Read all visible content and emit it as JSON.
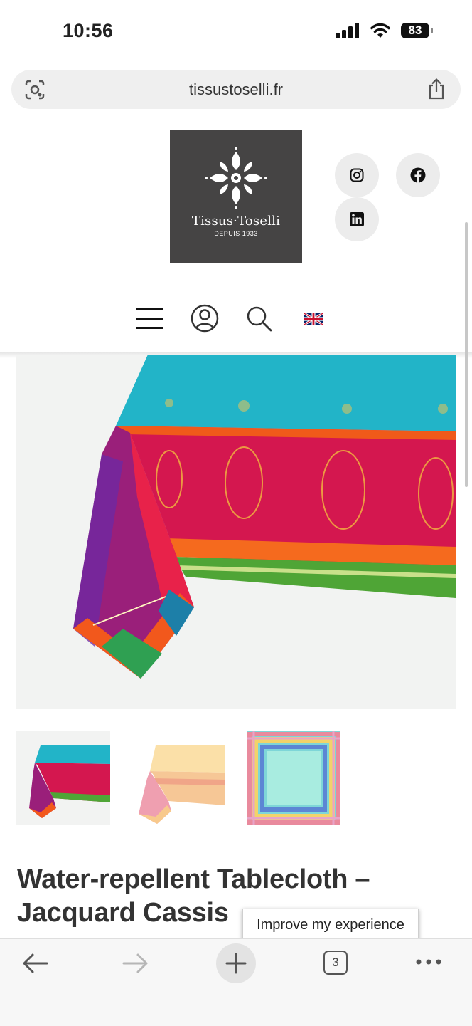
{
  "status_bar": {
    "time": "10:56",
    "battery": "83"
  },
  "browser": {
    "url": "tissustoselli.fr",
    "open_tabs": "3"
  },
  "header": {
    "logo_name": "Tissus·Toselli",
    "logo_tagline": "DEPUIS 1933",
    "social_icons": [
      "instagram-icon",
      "facebook-icon",
      "linkedin-icon"
    ],
    "nav_icons": [
      "menu-icon",
      "account-icon",
      "search-icon",
      "uk-flag-icon"
    ]
  },
  "product": {
    "title": "Water-repellent Tablecloth – Jacquard Cassis",
    "thumbnails": [
      "thumb-cassis",
      "thumb-peach",
      "thumb-pastel"
    ]
  },
  "cookie": {
    "improve_label": "Improve my experience"
  },
  "colors": {
    "turquoise": "#1fb3c9",
    "fuchsia": "#d4174f",
    "orange": "#f05a1a",
    "green": "#4fa536",
    "logo_bg": "#454444"
  }
}
